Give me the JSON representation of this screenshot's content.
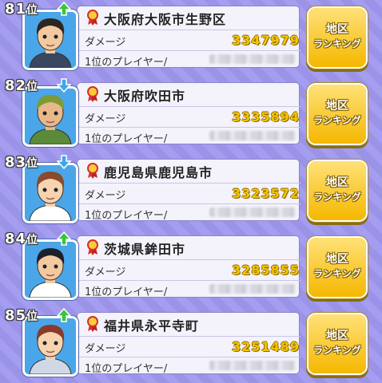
{
  "rows": [
    {
      "rank_num": "81",
      "rank_suffix": "位",
      "trend": "up",
      "region": "大阪府大阪市生野区",
      "damage_label": "ダメージ",
      "damage": "3347979",
      "top_label": "1位のプレイヤー/",
      "skin": "#f2c9a0",
      "hair": "#2d2620",
      "shirt": "#3b4660",
      "btn_line1": "地区",
      "btn_line2": "ランキング"
    },
    {
      "rank_num": "82",
      "rank_suffix": "位",
      "trend": "down",
      "region": "大阪府吹田市",
      "damage_label": "ダメージ",
      "damage": "3335894",
      "top_label": "1位のプレイヤー/",
      "skin": "#e9b88a",
      "hair": "#7c9a3a",
      "shirt": "#5a8a3a",
      "btn_line1": "地区",
      "btn_line2": "ランキング"
    },
    {
      "rank_num": "83",
      "rank_suffix": "位",
      "trend": "down",
      "region": "鹿児島県鹿児島市",
      "damage_label": "ダメージ",
      "damage": "3323572",
      "top_label": "1位のプレイヤー/",
      "skin": "#f7d3b0",
      "hair": "#8b4a2a",
      "shirt": "#ffffff",
      "btn_line1": "地区",
      "btn_line2": "ランキング"
    },
    {
      "rank_num": "84",
      "rank_suffix": "位",
      "trend": "up",
      "region": "茨城県鉾田市",
      "damage_label": "ダメージ",
      "damage": "3285855",
      "top_label": "1位のプレイヤー/",
      "skin": "#f3c9a0",
      "hair": "#1e2028",
      "shirt": "#ffffff",
      "btn_line1": "地区",
      "btn_line2": "ランキング"
    },
    {
      "rank_num": "85",
      "rank_suffix": "位",
      "trend": "up",
      "region": "福井県永平寺町",
      "damage_label": "ダメージ",
      "damage": "3251489",
      "top_label": "1位のプレイヤー/",
      "skin": "#f7d3b0",
      "hair": "#8a3a2a",
      "shirt": "#d0d8e8",
      "btn_line1": "地区",
      "btn_line2": "ランキング"
    }
  ],
  "colors": {
    "up": "#3cc43c",
    "down": "#3aa8e8",
    "damage": "#f5c400",
    "button": "#f5b800"
  }
}
